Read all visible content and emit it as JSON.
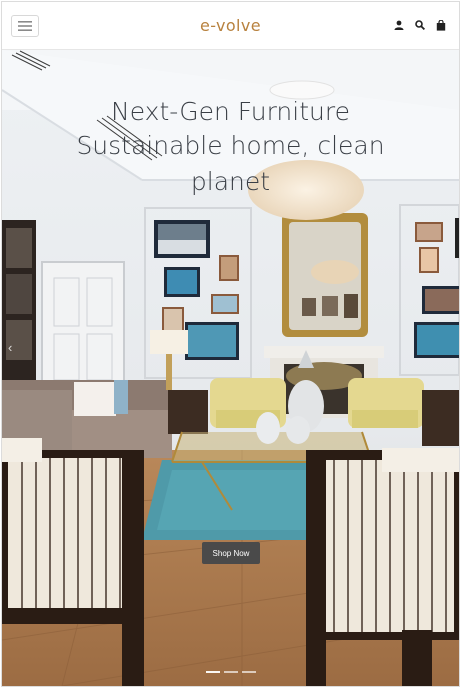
{
  "header": {
    "logo": "e-volve",
    "icons": [
      "menu-icon",
      "user-icon",
      "search-icon",
      "shopping-bag-icon"
    ]
  },
  "hero": {
    "headline_line1": "Next-Gen Furniture",
    "headline_line2": "Sustainable home, clean planet",
    "cta_label": "Shop Now",
    "slides": 3,
    "active_slide": 1
  },
  "colors": {
    "logo": "#b8823f",
    "headline": "#3a3f46",
    "cta_bg": "#4a4a4a"
  }
}
